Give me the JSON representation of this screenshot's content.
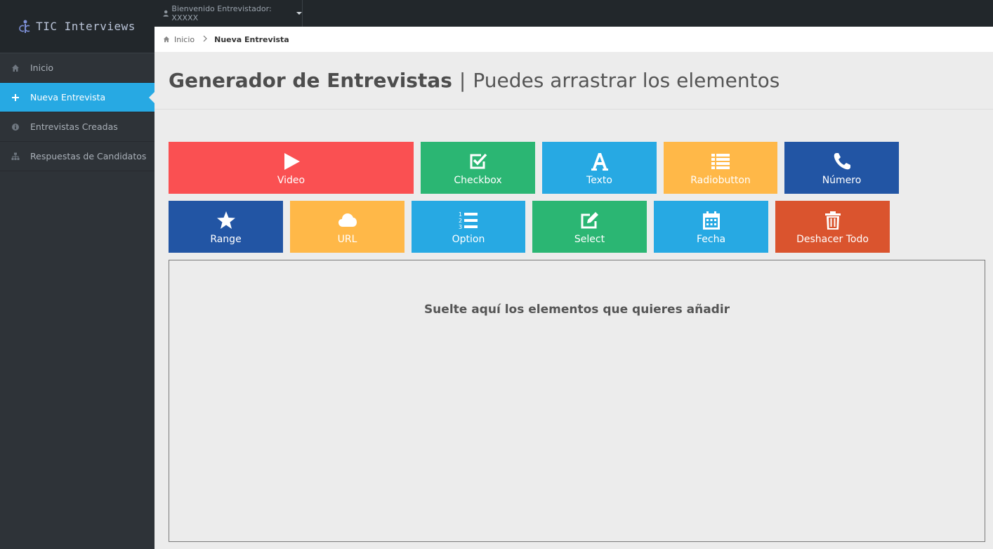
{
  "app": {
    "logo_text": "TIC Interviews"
  },
  "sidebar": {
    "items": [
      {
        "label": "Inicio",
        "icon": "home-icon"
      },
      {
        "label": "Nueva Entrevista",
        "icon": "plus-icon",
        "active": true
      },
      {
        "label": "Entrevistas Creadas",
        "icon": "info-icon"
      },
      {
        "label": "Respuestas de Candidatos",
        "icon": "sitemap-icon"
      }
    ]
  },
  "topbar": {
    "user_label": "Bienvenido Entrevistador: XXXXX"
  },
  "breadcrumb": {
    "home": "Inicio",
    "current": "Nueva Entrevista"
  },
  "header": {
    "title": "Generador de Entrevistas",
    "separator": "|",
    "subtitle": "Puedes arrastrar los elementos"
  },
  "tiles": [
    {
      "label": "Video",
      "icon": "play-icon",
      "color": "#fa5052"
    },
    {
      "label": "Checkbox",
      "icon": "check-square-icon",
      "color": "#2bb673"
    },
    {
      "label": "Texto",
      "icon": "font-icon",
      "color": "#27a9e3"
    },
    {
      "label": "Radiobutton",
      "icon": "list-icon",
      "color": "#ffb848"
    },
    {
      "label": "Número",
      "icon": "phone-icon",
      "color": "#2255a4"
    },
    {
      "label": "Range",
      "icon": "star-icon",
      "color": "#2255a4"
    },
    {
      "label": "URL",
      "icon": "cloud-icon",
      "color": "#ffb848"
    },
    {
      "label": "Option",
      "icon": "ordered-list-icon",
      "color": "#27a9e3"
    },
    {
      "label": "Select",
      "icon": "edit-icon",
      "color": "#2bb673"
    },
    {
      "label": "Fecha",
      "icon": "calendar-icon",
      "color": "#27a9e3"
    },
    {
      "label": "Deshacer Todo",
      "icon": "trash-icon",
      "color": "#da542e"
    }
  ],
  "dropzone": {
    "text": "Suelte aquí los elementos que quieres añadir"
  },
  "colors": {
    "accent": "#27a9e3",
    "sidebar_bg": "#2e3338",
    "topbar_bg": "#22272b"
  }
}
